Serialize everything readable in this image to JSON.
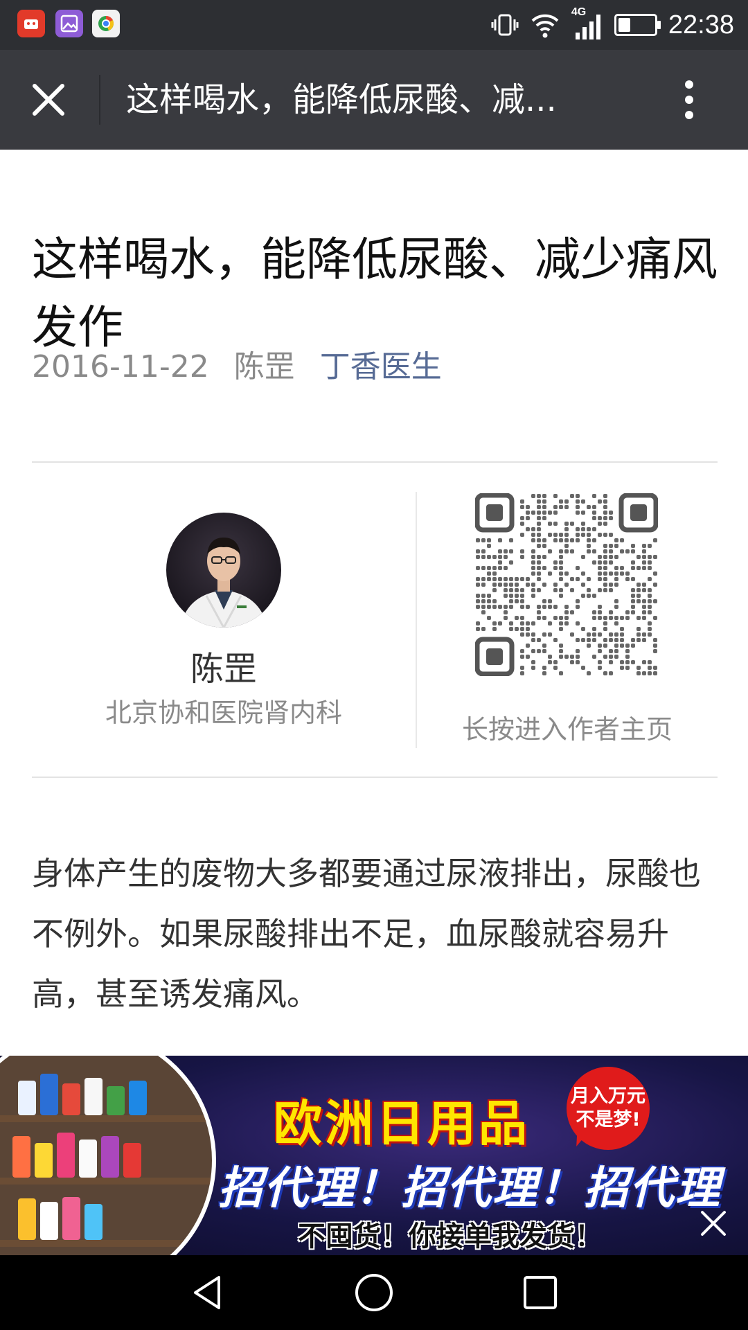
{
  "status_bar": {
    "time": "22:38",
    "network": "4G",
    "battery_level": 0.35,
    "app_icons": [
      "app-icon-red",
      "gallery-icon",
      "browser-icon"
    ]
  },
  "title_bar": {
    "title": "这样喝水，能降低尿酸、减..."
  },
  "article": {
    "title": "这样喝水，能降低尿酸、减少痛风发作",
    "date": "2016-11-22",
    "author": "陈罡",
    "source": "丁香医生",
    "paragraph": "身体产生的废物大多都要通过尿液排出，尿酸也不例外。如果尿酸排出不足，血尿酸就容易升高，甚至诱发痛风。"
  },
  "author_card": {
    "name": "陈罡",
    "department": "北京协和医院肾内科",
    "qr_caption": "长按进入作者主页"
  },
  "ad": {
    "headline": "欧洲日用品",
    "bubble_line1": "月入万元",
    "bubble_line2": "不是梦!",
    "slogan": "招代理！招代理！招代理",
    "subtitle": "不囤货！你接单我发货！"
  },
  "colors": {
    "status_bar": "#2d2f33",
    "title_bar": "#393a3f",
    "link": "#576b95",
    "meta_text": "#8a8a8a"
  }
}
